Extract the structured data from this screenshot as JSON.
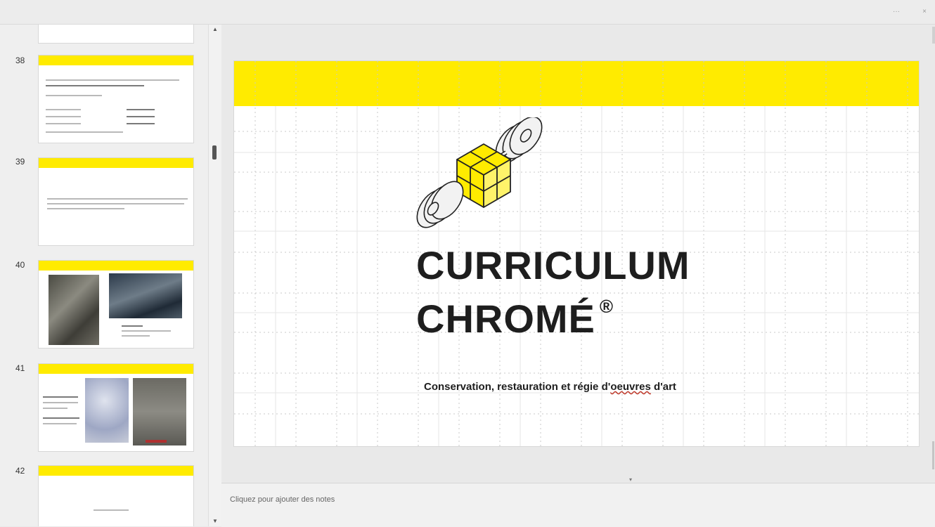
{
  "window": {
    "controls": [
      "···",
      "×"
    ]
  },
  "thumbnails": [
    {
      "number": "38"
    },
    {
      "number": "39"
    },
    {
      "number": "40"
    },
    {
      "number": "41"
    },
    {
      "number": "42"
    }
  ],
  "slide": {
    "title_line1": "CURRICULUM",
    "title_line2": "CHROMÉ",
    "registered_mark": "®",
    "subtitle_before": "Conservation, restauration et régie d'",
    "subtitle_misspelled": "oeuvres",
    "subtitle_after": " d'art"
  },
  "notes": {
    "placeholder": "Cliquez pour ajouter des notes"
  },
  "scroll": {
    "up_arrow": "▲",
    "down_arrow": "▼",
    "split_handle": "▾"
  },
  "colors": {
    "accent_yellow": "#ffeb00",
    "title_black": "#1e1e1e"
  },
  "icons": [
    "dumbbell-cube-logo-icon"
  ]
}
